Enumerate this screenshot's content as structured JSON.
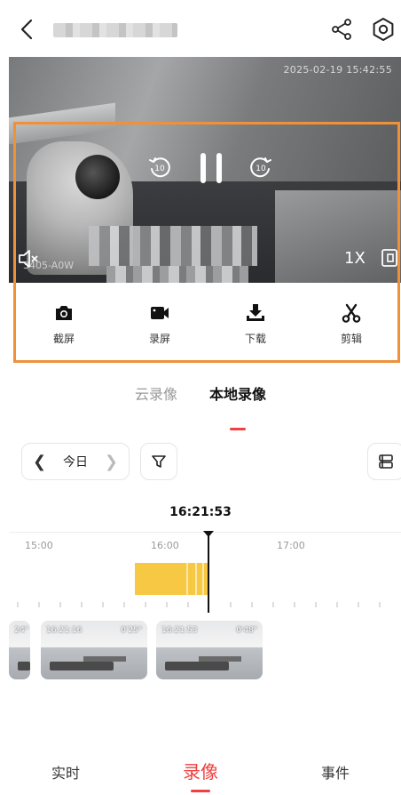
{
  "header": {
    "title_masked": true,
    "icons": [
      "back-icon",
      "share-icon",
      "settings-icon"
    ]
  },
  "video": {
    "timestamp": "2025-02-19 15:42:55",
    "device_label": "3405-A0W",
    "speed": "1X",
    "controls": [
      "rewind-10-icon",
      "pause-icon",
      "forward-10-icon",
      "mute-icon",
      "fullscreen-icon"
    ]
  },
  "actions": [
    {
      "label": "截屏",
      "icon": "camera-icon"
    },
    {
      "label": "录屏",
      "icon": "video-camera-icon"
    },
    {
      "label": "下载",
      "icon": "download-icon"
    },
    {
      "label": "剪辑",
      "icon": "scissors-icon"
    }
  ],
  "record_tabs": [
    {
      "label": "云录像",
      "active": false
    },
    {
      "label": "本地录像",
      "active": true
    }
  ],
  "date_filter": {
    "label": "今日"
  },
  "timeline": {
    "current_time": "16:21:53",
    "labels": [
      "15:00",
      "16:00",
      "17:00"
    ]
  },
  "clips": [
    {
      "time": "",
      "duration": "24\""
    },
    {
      "time": "16:21:16",
      "duration": "0'25\""
    },
    {
      "time": "16:21:53",
      "duration": "0'48\""
    }
  ],
  "bottom_nav": [
    {
      "label": "实时",
      "active": false
    },
    {
      "label": "录像",
      "active": true
    },
    {
      "label": "事件",
      "active": false
    }
  ],
  "colors": {
    "accent": "#f04040",
    "frame": "#f0913a",
    "recording": "#f7c843"
  }
}
